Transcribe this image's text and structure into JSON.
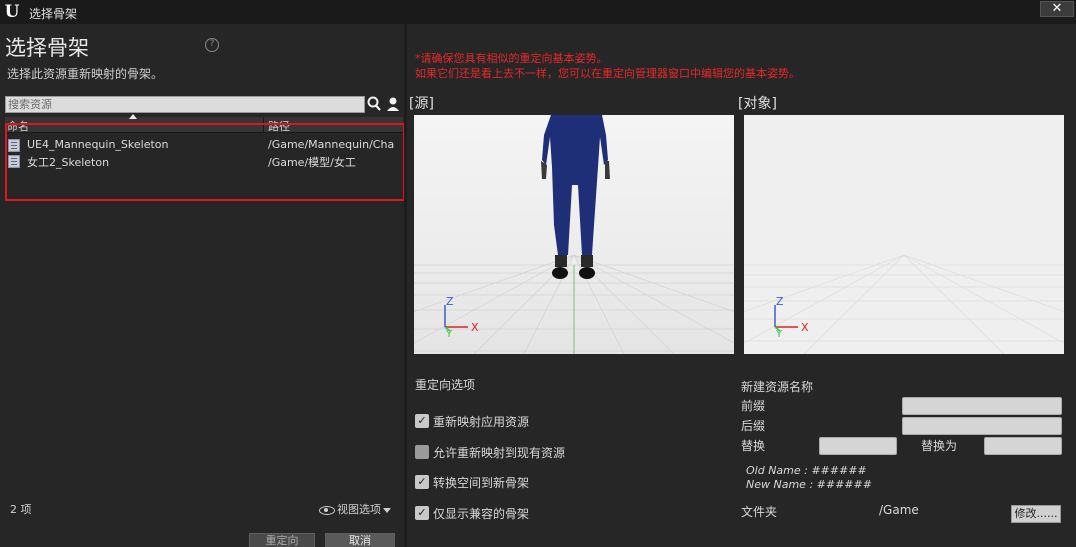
{
  "window": {
    "title": "选择骨架",
    "close_label": "✕"
  },
  "left": {
    "heading": "选择骨架",
    "help_label": "?",
    "description": "选择此资源重新映射的骨架。",
    "search": {
      "placeholder": "搜索资源",
      "value": ""
    },
    "columns": {
      "name": "命名",
      "path": "路径"
    },
    "assets": [
      {
        "name": "UE4_Mannequin_Skeleton",
        "path": "/Game/Mannequin/Cha"
      },
      {
        "name": "女工2_Skeleton",
        "path": "/Game/模型/女工"
      }
    ],
    "item_count": "2 项",
    "view_options": "视图选项",
    "buttons": {
      "retarget": "重定向",
      "cancel": "取消"
    }
  },
  "right": {
    "warning_line1": "*请确保您具有相似的重定向基本姿势。",
    "warning_line2": "如果它们还是看上去不一样，您可以在重定向管理器窗口中编辑您的基本姿势。",
    "source_label": "[源]",
    "target_label": "[对象]",
    "axis": {
      "z": "Z",
      "y": "Y",
      "x": "X"
    },
    "retarget_options": {
      "title": "重定向选项",
      "items": [
        {
          "label": "重新映射应用资源",
          "checked": true
        },
        {
          "label": "允许重新映射到现有资源",
          "checked": false
        },
        {
          "label": "转换空间到新骨架",
          "checked": true
        },
        {
          "label": "仅显示兼容的骨架",
          "checked": true
        }
      ]
    },
    "new_asset": {
      "title": "新建资源名称",
      "prefix_label": "前缀",
      "prefix_value": "",
      "suffix_label": "后缀",
      "suffix_value": "",
      "replace_label": "替换",
      "replace_value": "",
      "replace_with_label": "替换为",
      "replace_with_value": "",
      "old_name_example": "Old Name : ######",
      "new_name_example": "New Name : ######",
      "folder_label": "文件夹",
      "folder_value": "/Game",
      "modify_label": "修改......"
    }
  },
  "colors": {
    "warning": "#e8282a",
    "highlight": "#e0141b",
    "axis_x": "#e02020",
    "axis_y": "#2ecc40",
    "axis_z": "#3a5bd9"
  }
}
